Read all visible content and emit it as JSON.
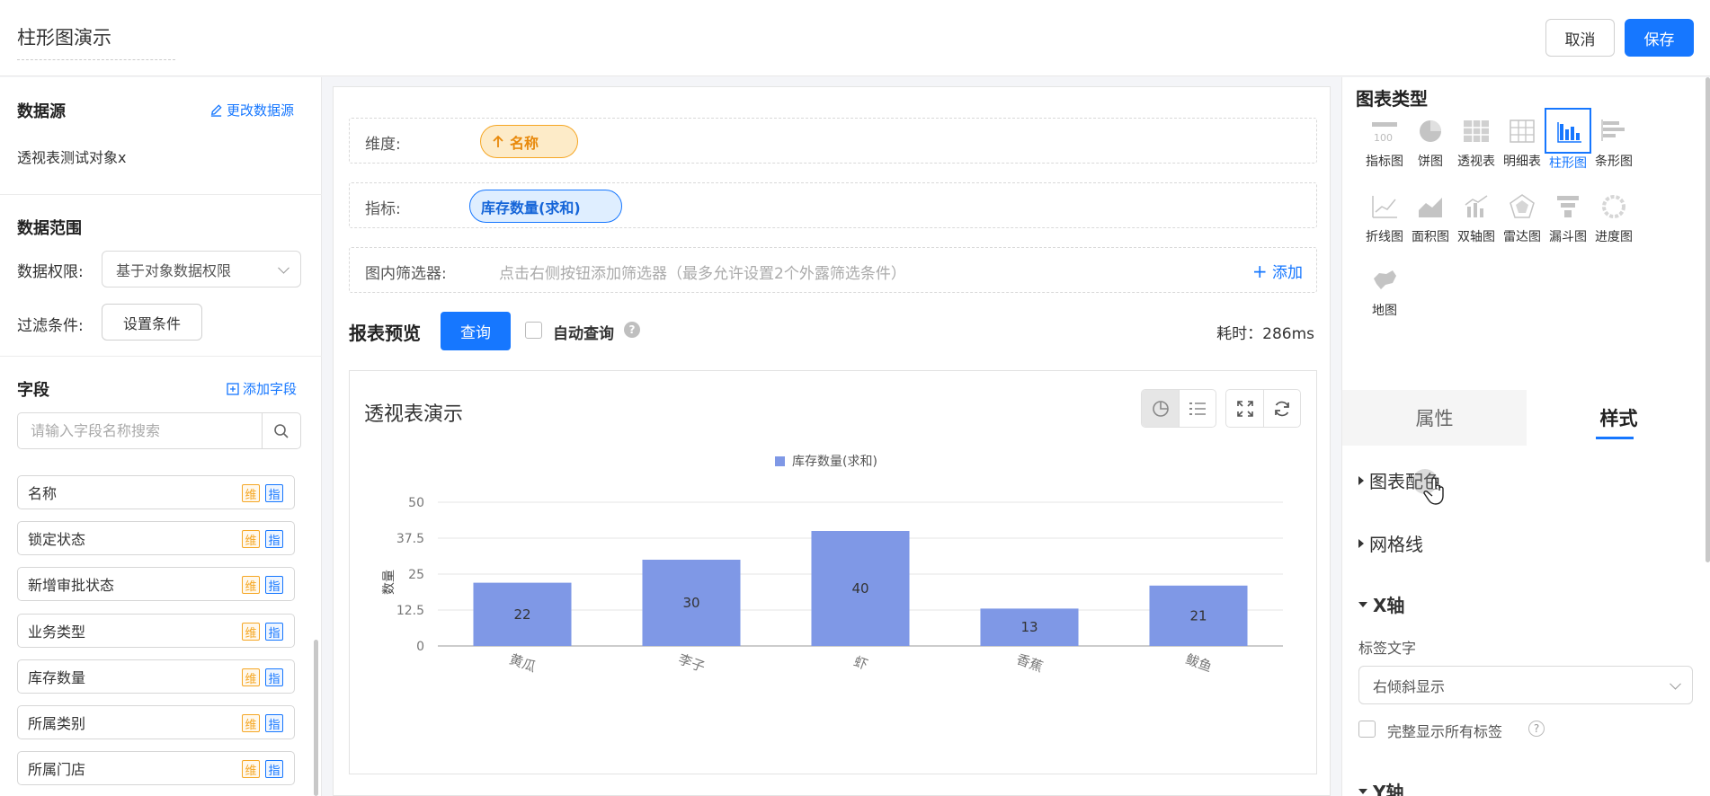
{
  "header": {
    "title": "柱形图演示",
    "cancel_label": "取消",
    "save_label": "保存"
  },
  "left": {
    "datasource": {
      "title": "数据源",
      "change_label": "更改数据源",
      "name": "透视表测试对象x"
    },
    "scope": {
      "title": "数据范围",
      "permission_label": "数据权限:",
      "permission_value": "基于对象数据权限",
      "filter_label": "过滤条件:",
      "filter_button": "设置条件"
    },
    "fields": {
      "title": "字段",
      "add_label": "添加字段",
      "search_placeholder": "请输入字段名称搜索",
      "tag_dimension": "维",
      "tag_metric": "指",
      "items": [
        {
          "label": "名称"
        },
        {
          "label": "锁定状态"
        },
        {
          "label": "新增审批状态"
        },
        {
          "label": "业务类型"
        },
        {
          "label": "库存数量"
        },
        {
          "label": "所属类别"
        },
        {
          "label": "所属门店"
        }
      ]
    }
  },
  "center": {
    "dimension": {
      "label": "维度:",
      "pill": "名称"
    },
    "metric": {
      "label": "指标:",
      "pill": "库存数量(求和)"
    },
    "filter": {
      "label": "图内筛选器:",
      "hint": "点击右侧按钮添加筛选器（最多允许设置2个外露筛选条件）",
      "add_label": "添加"
    },
    "preview": {
      "title": "报表预览",
      "query_button": "查询",
      "auto_query_label": "自动查询",
      "auto_query_checked": false,
      "elapsed_text": "耗时：286ms"
    },
    "chart_card_title": "透视表演示"
  },
  "chart_data": {
    "type": "bar",
    "categories": [
      "黄瓜",
      "李子",
      "虾",
      "香蕉",
      "鲅鱼"
    ],
    "series": [
      {
        "name": "库存数量(求和)",
        "values": [
          22,
          30,
          40,
          13,
          21
        ]
      }
    ],
    "ylabel": "数量",
    "xlabel": "",
    "ylim": [
      0,
      50
    ],
    "yticks": [
      0,
      12.5,
      25,
      37.5,
      50
    ],
    "legend": "top-center",
    "bar_color": "#7f98e6",
    "grid": true
  },
  "right": {
    "chart_types_title": "图表类型",
    "chart_types": [
      {
        "label": "指标图",
        "icon": "indicator-chart-icon"
      },
      {
        "label": "饼图",
        "icon": "pie-chart-icon"
      },
      {
        "label": "透视表",
        "icon": "pivot-table-icon"
      },
      {
        "label": "明细表",
        "icon": "detail-table-icon"
      },
      {
        "label": "柱形图",
        "icon": "column-chart-icon",
        "active": true
      },
      {
        "label": "条形图",
        "icon": "bar-chart-icon"
      },
      {
        "label": "折线图",
        "icon": "line-chart-icon"
      },
      {
        "label": "面积图",
        "icon": "area-chart-icon"
      },
      {
        "label": "双轴图",
        "icon": "dual-axis-chart-icon"
      },
      {
        "label": "雷达图",
        "icon": "radar-chart-icon"
      },
      {
        "label": "漏斗图",
        "icon": "funnel-chart-icon"
      },
      {
        "label": "进度图",
        "icon": "progress-chart-icon"
      },
      {
        "label": "地图",
        "icon": "map-chart-icon"
      }
    ],
    "tabs": {
      "properties": "属性",
      "style": "样式"
    },
    "sections": {
      "palette": "图表配色",
      "gridlines": "网格线",
      "x_axis": "X轴",
      "label_text": "标签文字",
      "label_value": "右倾斜显示",
      "show_all_labels": "完整显示所有标签",
      "y_axis": "Y轴"
    }
  },
  "colors": {
    "accent": "#1677ff",
    "dimension": "#f5a623",
    "bar": "#7f98e6"
  }
}
